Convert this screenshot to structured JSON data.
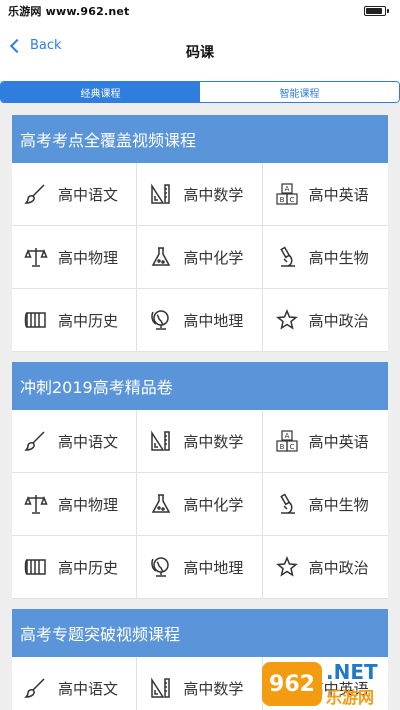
{
  "status_bar": {
    "watermark": "乐游网 www.962.net"
  },
  "nav": {
    "back_label": "Back",
    "title": "码课"
  },
  "tabs": [
    {
      "label": "经典课程",
      "active": true
    },
    {
      "label": "智能课程",
      "active": false
    }
  ],
  "sections": [
    {
      "title": "高考考点全覆盖视频课程",
      "items": [
        {
          "label": "高中语文",
          "icon": "brush-icon"
        },
        {
          "label": "高中数学",
          "icon": "ruler-icon"
        },
        {
          "label": "高中英语",
          "icon": "abc-blocks-icon"
        },
        {
          "label": "高中物理",
          "icon": "scales-icon"
        },
        {
          "label": "高中化学",
          "icon": "flask-icon"
        },
        {
          "label": "高中生物",
          "icon": "microscope-icon"
        },
        {
          "label": "高中历史",
          "icon": "scroll-icon"
        },
        {
          "label": "高中地理",
          "icon": "globe-icon"
        },
        {
          "label": "高中政治",
          "icon": "star-icon"
        }
      ]
    },
    {
      "title": "冲刺2019高考精品卷",
      "items": [
        {
          "label": "高中语文",
          "icon": "brush-icon"
        },
        {
          "label": "高中数学",
          "icon": "ruler-icon"
        },
        {
          "label": "高中英语",
          "icon": "abc-blocks-icon"
        },
        {
          "label": "高中物理",
          "icon": "scales-icon"
        },
        {
          "label": "高中化学",
          "icon": "flask-icon"
        },
        {
          "label": "高中生物",
          "icon": "microscope-icon"
        },
        {
          "label": "高中历史",
          "icon": "scroll-icon"
        },
        {
          "label": "高中地理",
          "icon": "globe-icon"
        },
        {
          "label": "高中政治",
          "icon": "star-icon"
        }
      ]
    },
    {
      "title": "高考专题突破视频课程",
      "items": [
        {
          "label": "高中语文",
          "icon": "brush-icon"
        },
        {
          "label": "高中数学",
          "icon": "ruler-icon"
        },
        {
          "label": "高中英语",
          "icon": "abc-blocks-icon"
        }
      ]
    }
  ],
  "watermark": {
    "badge": "962",
    "net": ".NET",
    "site": "乐游网"
  },
  "colors": {
    "accent": "#2f7ddf",
    "section_header": "#5b95d9",
    "background": "#eeeeee"
  }
}
